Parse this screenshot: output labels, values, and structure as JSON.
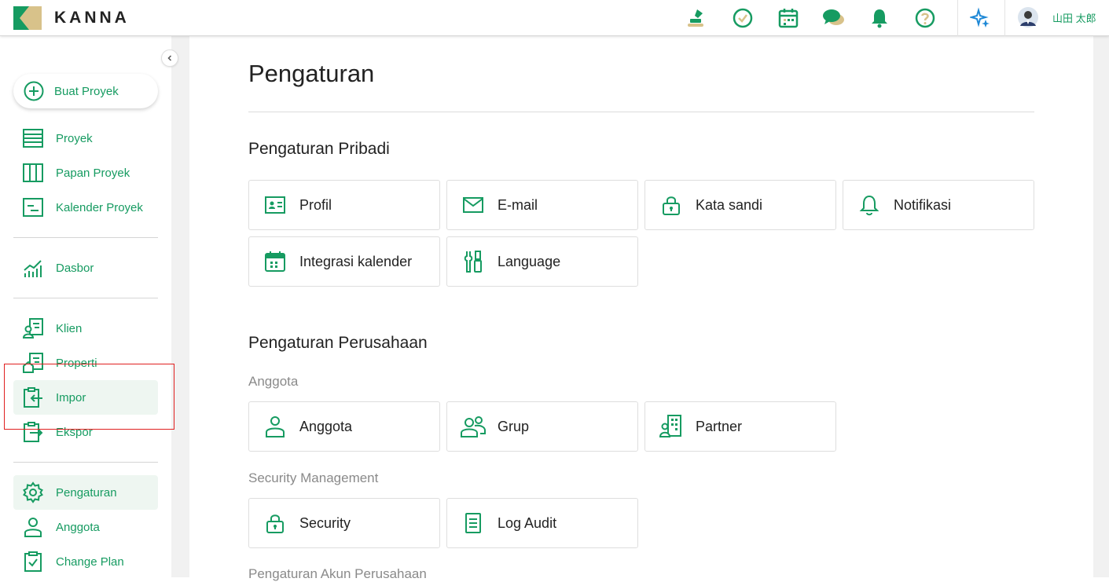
{
  "app": {
    "logo_text": "KANNA"
  },
  "header": {
    "icons": [
      "stamp-icon",
      "check-circle-icon",
      "calendar-icon",
      "chat-icon",
      "bell-icon",
      "help-icon",
      "ai-sparkle-icon"
    ],
    "user_name": "山田 太郎"
  },
  "sidebar": {
    "create_label": "Buat Proyek",
    "items": [
      {
        "label": "Proyek"
      },
      {
        "label": "Papan Proyek"
      },
      {
        "label": "Kalender Proyek"
      },
      {
        "label": "Dasbor"
      },
      {
        "label": "Klien"
      },
      {
        "label": "Properti"
      },
      {
        "label": "Impor"
      },
      {
        "label": "Ekspor"
      },
      {
        "label": "Pengaturan"
      },
      {
        "label": "Anggota"
      },
      {
        "label": "Change Plan"
      }
    ]
  },
  "main": {
    "title": "Pengaturan",
    "personal": {
      "title": "Pengaturan Pribadi",
      "cards": [
        {
          "label": "Profil"
        },
        {
          "label": "E-mail"
        },
        {
          "label": "Kata sandi"
        },
        {
          "label": "Notifikasi"
        },
        {
          "label": "Integrasi kalender"
        },
        {
          "label": "Language"
        }
      ]
    },
    "company": {
      "title": "Pengaturan Perusahaan",
      "member_group": "Anggota",
      "member_cards": [
        {
          "label": "Anggota"
        },
        {
          "label": "Grup"
        },
        {
          "label": "Partner"
        }
      ],
      "security_group": "Security Management",
      "security_cards": [
        {
          "label": "Security"
        },
        {
          "label": "Log Audit"
        }
      ],
      "account_group": "Pengaturan Akun Perusahaan"
    }
  },
  "colors": {
    "brand": "#169b61",
    "highlight": "#e02020",
    "logo_gold": "#d8c28a"
  }
}
